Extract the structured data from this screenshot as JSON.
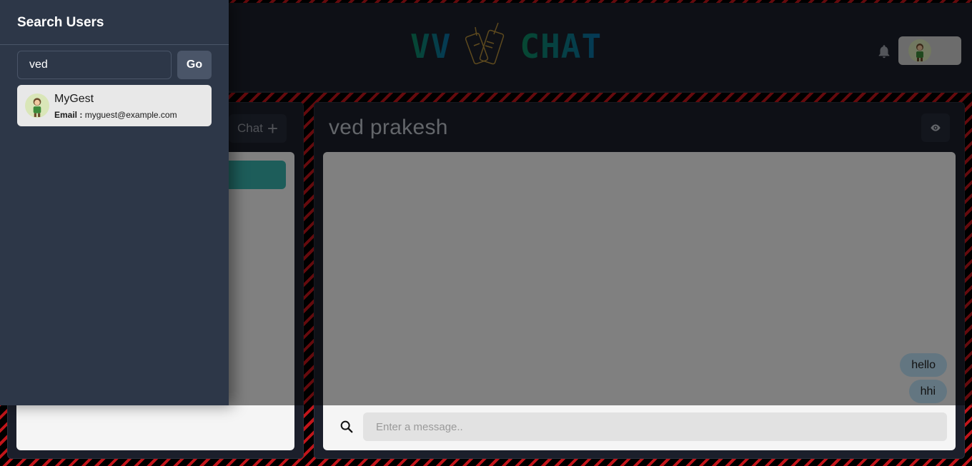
{
  "app": {
    "logo_left": "VV",
    "logo_right": "CHAT"
  },
  "header": {
    "notification_icon": "bell-icon",
    "profile_icon": "avatar-icon"
  },
  "chats_panel": {
    "new_group_label": "Chat",
    "new_group_icon": "plus-icon"
  },
  "chat": {
    "title": "ved prakesh",
    "view_profile_icon": "eye-icon",
    "messages": [
      {
        "text": "hello",
        "sender": "self"
      },
      {
        "text": "hhi",
        "sender": "self"
      }
    ],
    "input_placeholder": "Enter a message..",
    "input_value": ""
  },
  "drawer": {
    "title": "Search Users",
    "search_value": "ved",
    "go_label": "Go",
    "results": [
      {
        "name": "MyGest",
        "email_label": "Email :",
        "email": "myguest@example.com"
      }
    ]
  },
  "colors": {
    "accent": "#38b2ac",
    "drawer_bg": "#2d3748",
    "bubble": "#bee3f8",
    "panel_bg": "#1b1f2b"
  }
}
